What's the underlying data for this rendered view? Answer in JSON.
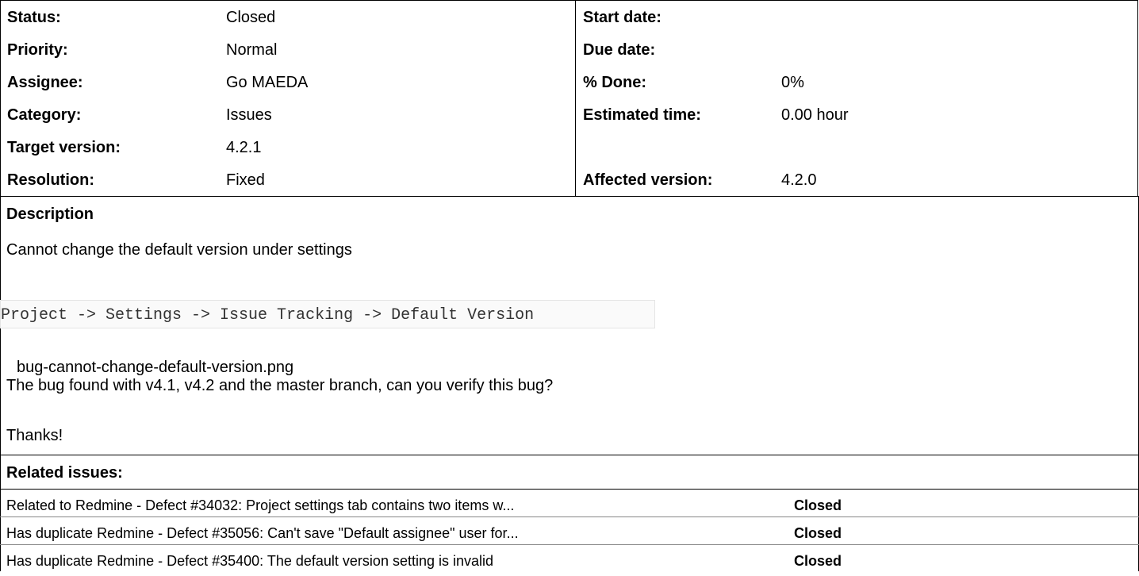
{
  "attributes": {
    "left": [
      {
        "label": "Status:",
        "value": "Closed"
      },
      {
        "label": "Priority:",
        "value": "Normal"
      },
      {
        "label": "Assignee:",
        "value": "Go MAEDA"
      },
      {
        "label": "Category:",
        "value": "Issues"
      },
      {
        "label": "Target version:",
        "value": "4.2.1"
      },
      {
        "label": "Resolution:",
        "value": "Fixed"
      }
    ],
    "right": [
      {
        "label": "Start date:",
        "value": ""
      },
      {
        "label": "Due date:",
        "value": ""
      },
      {
        "label": "% Done:",
        "value": "0%"
      },
      {
        "label": "Estimated time:",
        "value": "0.00 hour"
      },
      {
        "label": "",
        "value": ""
      },
      {
        "label": "Affected version:",
        "value": "4.2.0"
      }
    ]
  },
  "description": {
    "title": "Description",
    "line1": "Cannot change the default version under settings",
    "code": "Project -> Settings -> Issue Tracking -> Default Version",
    "attachment": "bug-cannot-change-default-version.png",
    "line2": "The bug found with v4.1, v4.2 and the master branch, can you verify this bug?",
    "line3": "Thanks!"
  },
  "related": {
    "title": "Related issues:",
    "items": [
      {
        "subject": "Related to Redmine - Defect #34032: Project settings tab contains two items w...",
        "status": "Closed"
      },
      {
        "subject": "Has duplicate Redmine - Defect #35056: Can't save \"Default assignee\" user for...",
        "status": "Closed"
      },
      {
        "subject": "Has duplicate Redmine - Defect #35400: The default version setting is invalid",
        "status": "Closed"
      }
    ]
  }
}
